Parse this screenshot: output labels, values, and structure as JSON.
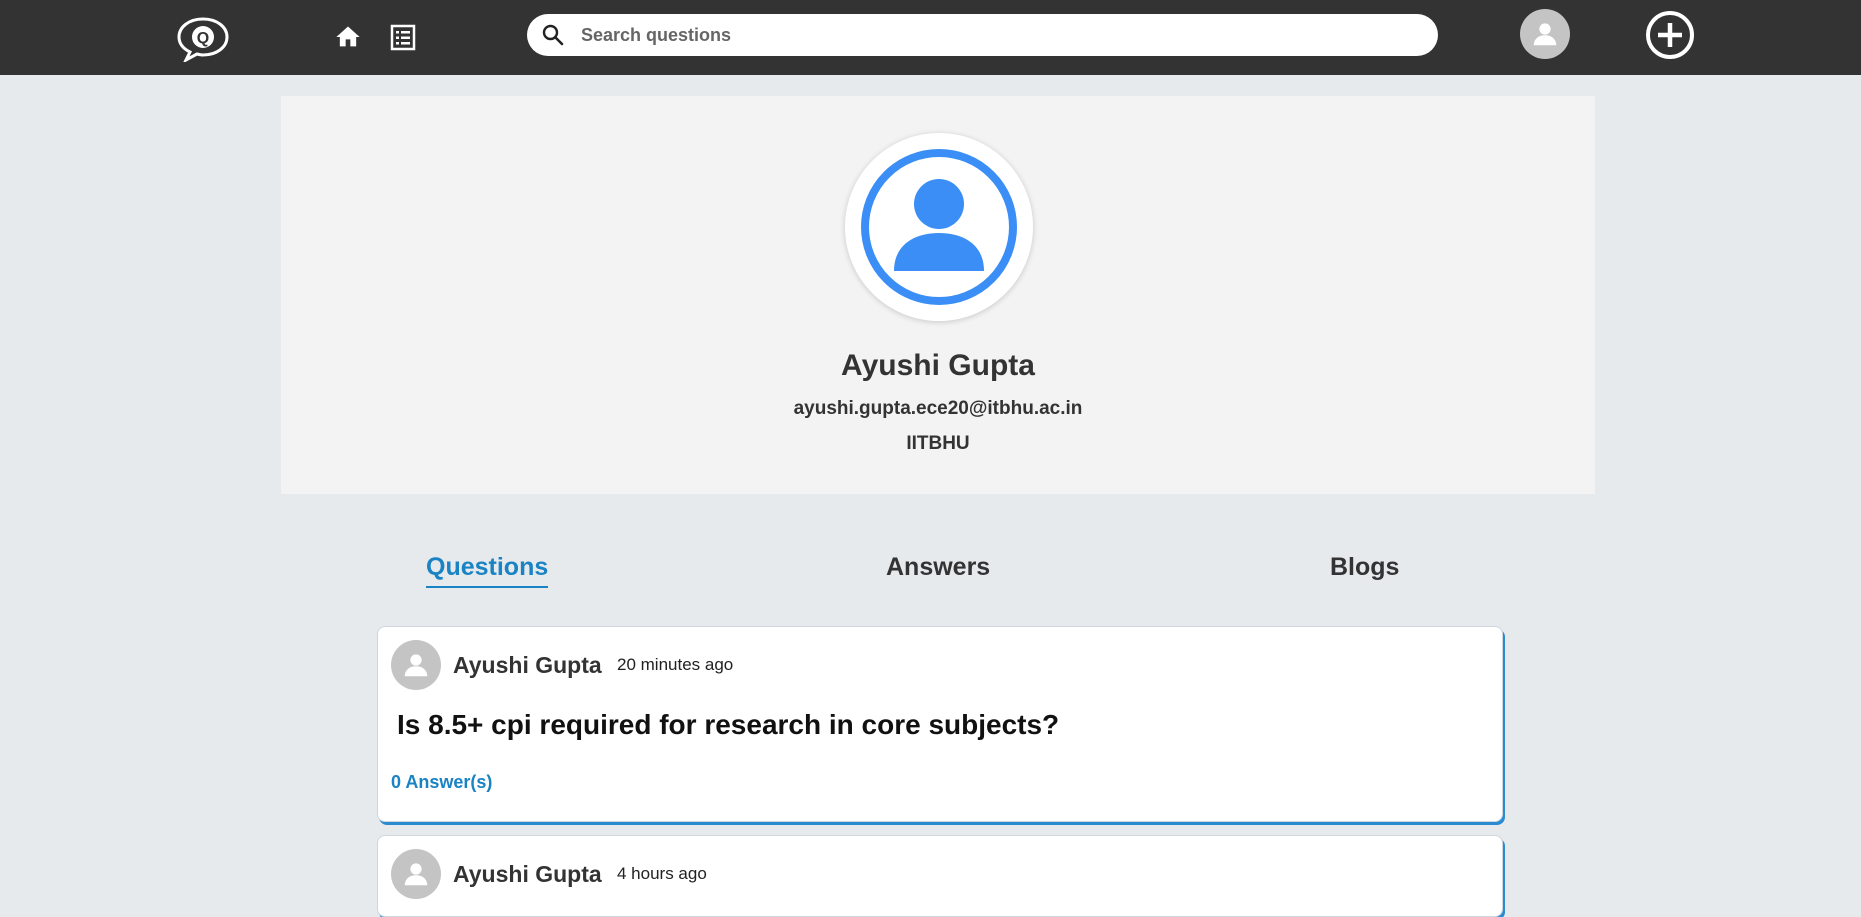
{
  "navbar": {
    "logo_letter": "Q",
    "search_placeholder": "Search questions"
  },
  "profile": {
    "name": "Ayushi Gupta",
    "email": "ayushi.gupta.ece20@itbhu.ac.in",
    "organization": "IITBHU"
  },
  "tabs": [
    {
      "label": "Questions",
      "active": true
    },
    {
      "label": "Answers",
      "active": false
    },
    {
      "label": "Blogs",
      "active": false
    }
  ],
  "questions": [
    {
      "author": "Ayushi Gupta",
      "time": "20 minutes ago",
      "title": "Is 8.5+ cpi required for research in core subjects?",
      "answers": "0 Answer(s)"
    },
    {
      "author": "Ayushi Gupta",
      "time": "4 hours ago"
    }
  ],
  "colors": {
    "navbar": "#333333",
    "accent": "#1a83c4",
    "avatar_blue": "#3a8ef6",
    "page_bg": "#e7eaed"
  }
}
